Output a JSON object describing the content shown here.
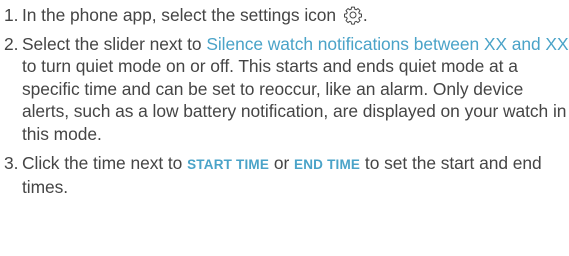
{
  "steps": [
    {
      "number": "1.",
      "text_before_icon": "In the phone app, select the settings icon",
      "icon": "gear-icon",
      "text_after_icon": "."
    },
    {
      "number": "2.",
      "prefix": "Select the slider next to ",
      "highlight": "Silence watch notifications between XX and XX",
      "suffix": " to turn quiet mode on or off. This starts and ends quiet mode at a specific time and can be set to reoccur, like an alarm. Only device alerts, such as a low battery notification, are displayed on your watch in this mode."
    },
    {
      "number": "3.",
      "prefix": "Click the time next to ",
      "start_label": "START TIME",
      "middle": " or ",
      "end_label": "END TIME",
      "suffix": " to set the start and end times."
    }
  ],
  "colors": {
    "text": "#454545",
    "accent": "#4aa3c8"
  }
}
